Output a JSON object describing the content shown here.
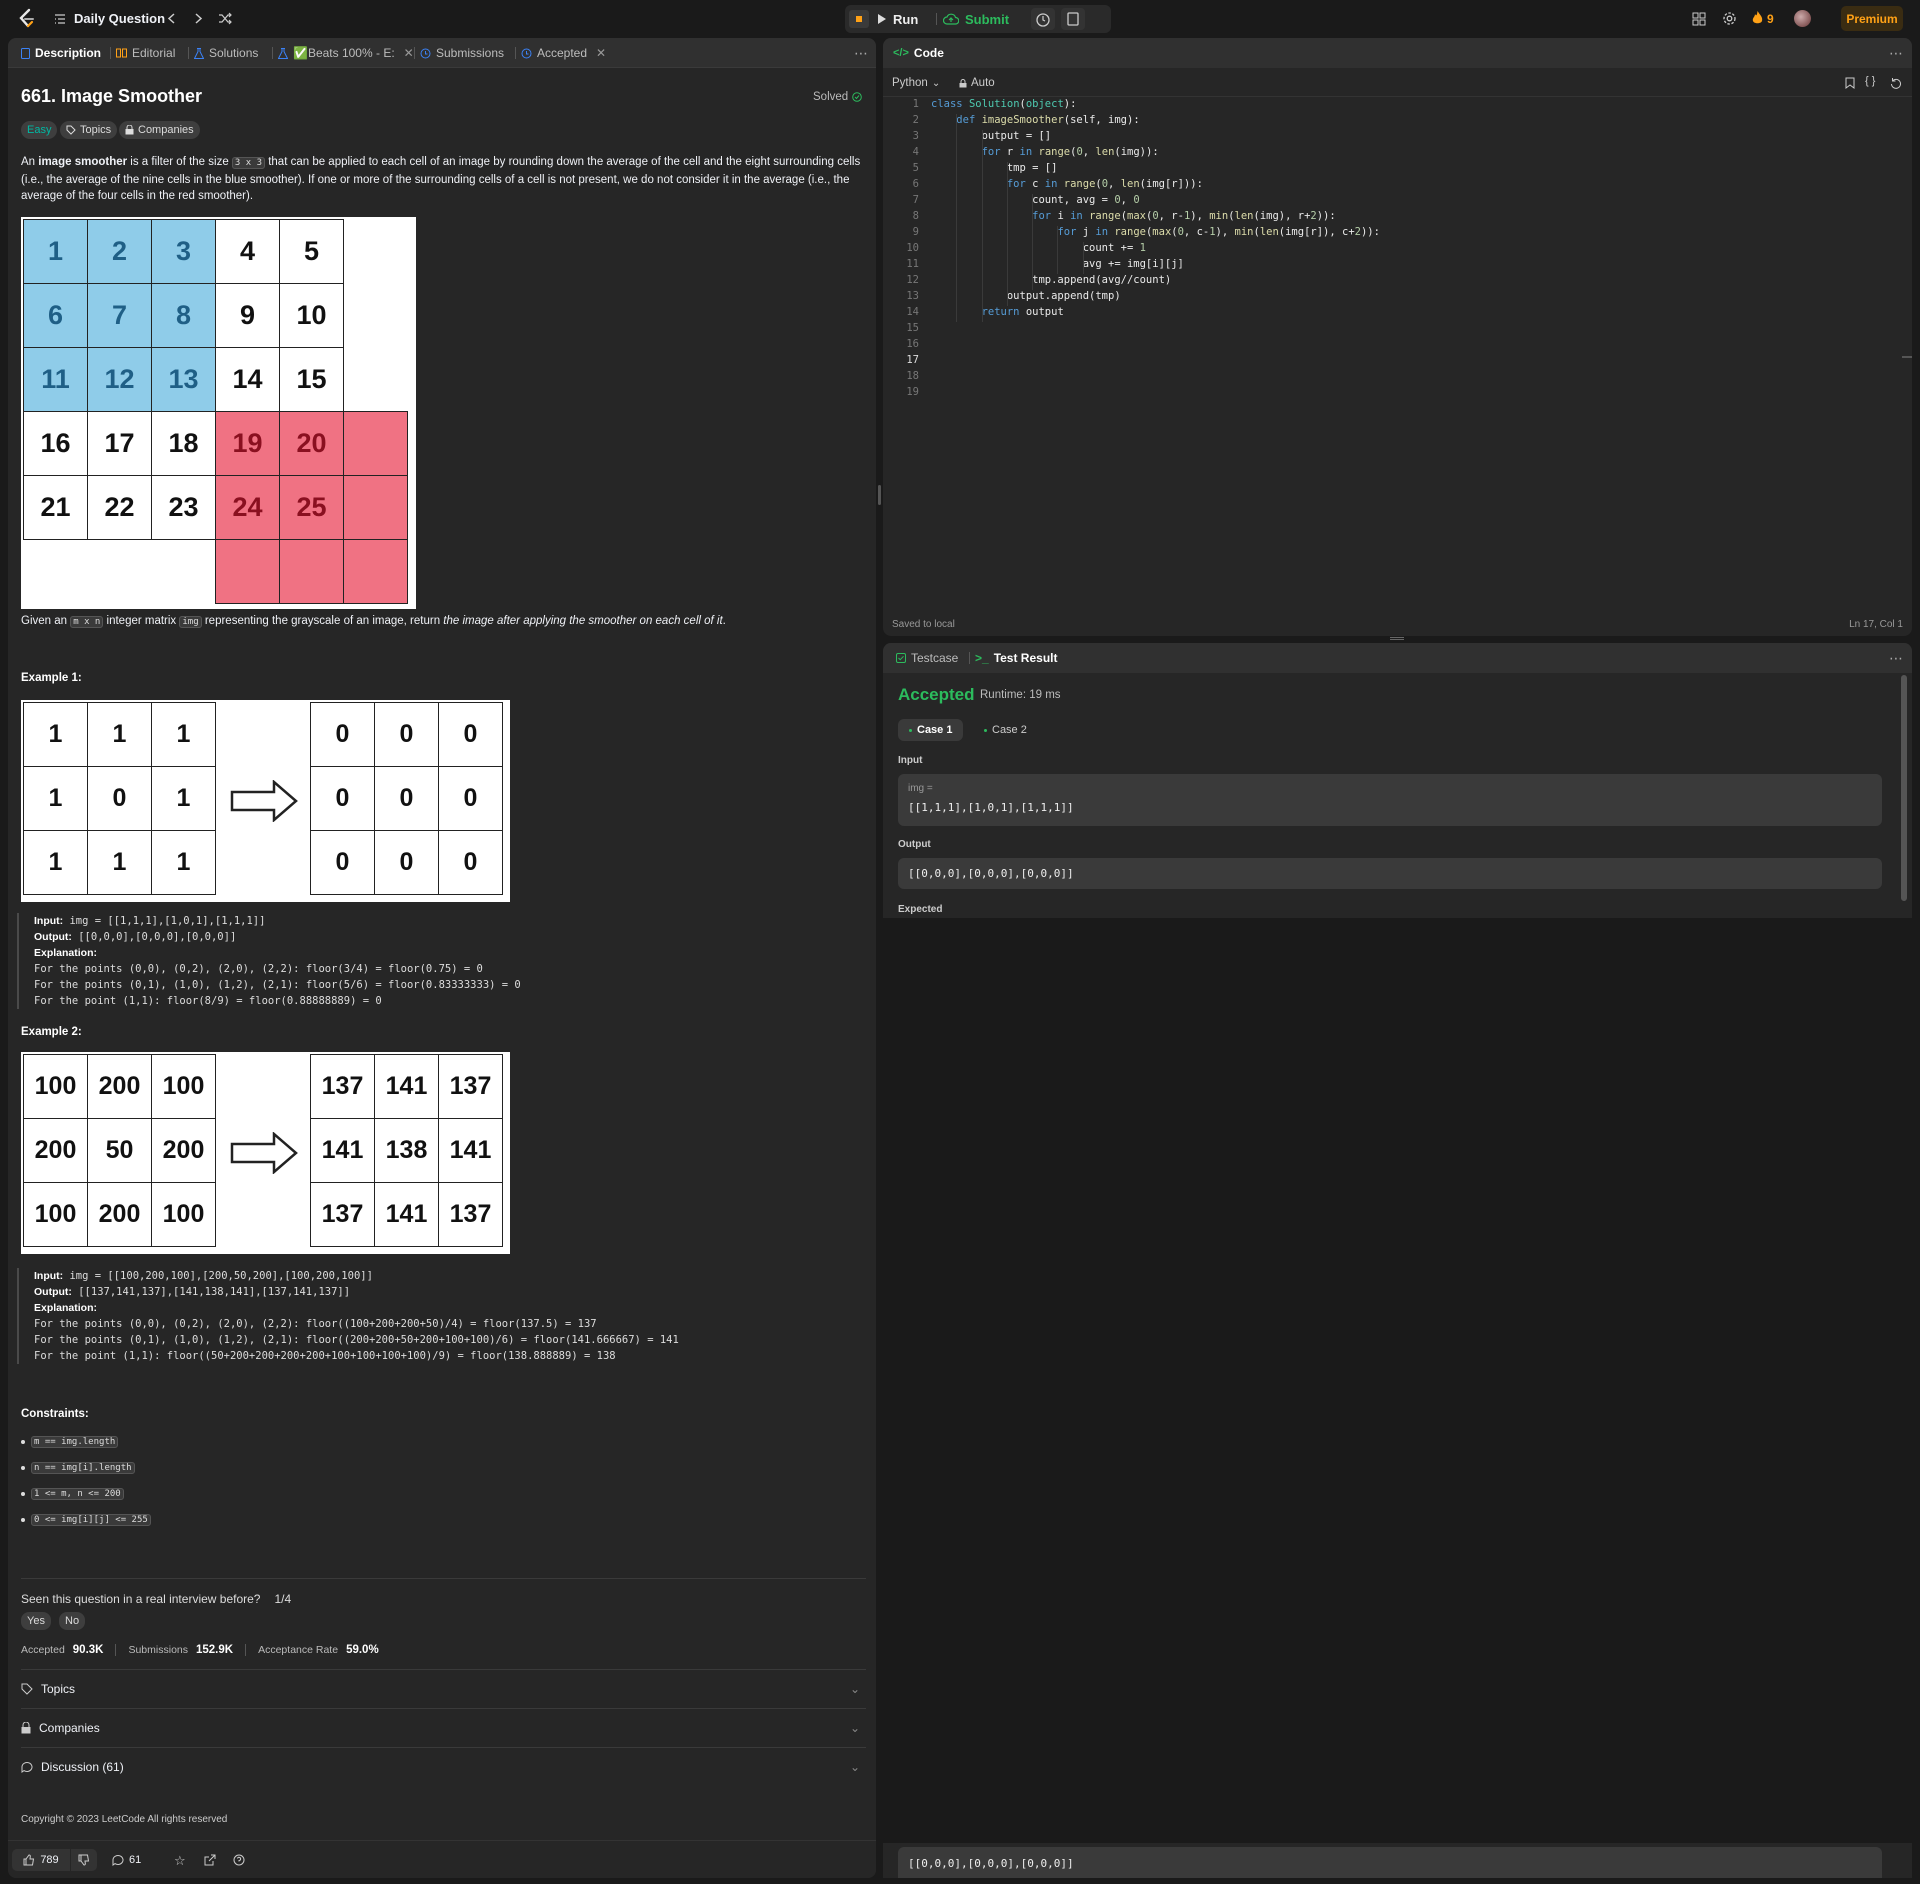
{
  "topbar": {
    "daily_question": "Daily Question",
    "run": "Run",
    "submit": "Submit",
    "streak": "9",
    "premium": "Premium"
  },
  "left_tabs": [
    {
      "label": "Description"
    },
    {
      "label": "Editorial"
    },
    {
      "label": "Solutions"
    },
    {
      "label": "✅Beats 100% - E:"
    },
    {
      "label": "Submissions"
    },
    {
      "label": "Accepted"
    }
  ],
  "problem": {
    "title": "661. Image Smoother",
    "solved": "Solved",
    "difficulty": "Easy",
    "topics_chip": "Topics",
    "companies_chip": "Companies",
    "desc_1": "An ",
    "desc_bold": "image smoother",
    "desc_2": " is a filter of the size ",
    "desc_code": "3 x 3",
    "desc_3": " that can be applied to each cell of an image by rounding down the average of the cell and the eight surrounding cells (i.e., the average of the nine cells in the blue smoother). If one or more of the surrounding cells of a cell is not present, we do not consider it in the average (i.e., the average of the four cells in the red smoother).",
    "given_1": "Given an ",
    "given_code1": "m x n",
    "given_2": " integer matrix ",
    "given_code2": "img",
    "given_3": " representing the grayscale of an image, return ",
    "given_italic": "the image after applying the smoother on each cell of it",
    "given_4": "."
  },
  "smoother_grid": [
    [
      "1",
      "2",
      "3",
      "4",
      "5"
    ],
    [
      "6",
      "7",
      "8",
      "9",
      "10"
    ],
    [
      "11",
      "12",
      "13",
      "14",
      "15"
    ],
    [
      "16",
      "17",
      "18",
      "19",
      "20"
    ],
    [
      "21",
      "22",
      "23",
      "24",
      "25"
    ]
  ],
  "example1": {
    "heading": "Example 1:",
    "in_grid": [
      [
        "1",
        "1",
        "1"
      ],
      [
        "1",
        "0",
        "1"
      ],
      [
        "1",
        "1",
        "1"
      ]
    ],
    "out_grid": [
      [
        "0",
        "0",
        "0"
      ],
      [
        "0",
        "0",
        "0"
      ],
      [
        "0",
        "0",
        "0"
      ]
    ],
    "input_label": "Input:",
    "input": " img = [[1,1,1],[1,0,1],[1,1,1]]",
    "output_label": "Output:",
    "output": " [[0,0,0],[0,0,0],[0,0,0]]",
    "explanation_label": "Explanation:",
    "lines": [
      "For the points (0,0), (0,2), (2,0), (2,2): floor(3/4) = floor(0.75) = 0",
      "For the points (0,1), (1,0), (1,2), (2,1): floor(5/6) = floor(0.83333333) = 0",
      "For the point (1,1): floor(8/9) = floor(0.88888889) = 0"
    ]
  },
  "example2": {
    "heading": "Example 2:",
    "in_grid": [
      [
        "100",
        "200",
        "100"
      ],
      [
        "200",
        "50",
        "200"
      ],
      [
        "100",
        "200",
        "100"
      ]
    ],
    "out_grid": [
      [
        "137",
        "141",
        "137"
      ],
      [
        "141",
        "138",
        "141"
      ],
      [
        "137",
        "141",
        "137"
      ]
    ],
    "input_label": "Input:",
    "input": " img = [[100,200,100],[200,50,200],[100,200,100]]",
    "output_label": "Output:",
    "output": " [[137,141,137],[141,138,141],[137,141,137]]",
    "explanation_label": "Explanation:",
    "lines": [
      "For the points (0,0), (0,2), (2,0), (2,2): floor((100+200+200+50)/4) = floor(137.5) = 137",
      "For the points (0,1), (1,0), (1,2), (2,1): floor((200+200+50+200+100+100)/6) = floor(141.666667) = 141",
      "For the point (1,1): floor((50+200+200+200+200+100+100+100+100)/9) = floor(138.888889) = 138"
    ]
  },
  "constraints": {
    "heading": "Constraints:",
    "items": [
      "m == img.length",
      "n == img[i].length",
      "1 <= m, n <= 200",
      "0 <= img[i][j] <= 255"
    ]
  },
  "interview": {
    "question": "Seen this question in a real interview before?",
    "count": "1/4",
    "yes": "Yes",
    "no": "No"
  },
  "stats": {
    "accepted_label": "Accepted",
    "accepted": "90.3K",
    "submissions_label": "Submissions",
    "submissions": "152.9K",
    "rate_label": "Acceptance Rate",
    "rate": "59.0%"
  },
  "accordions": [
    "Topics",
    "Companies",
    "Discussion (61)"
  ],
  "copyright": "Copyright © 2023 LeetCode All rights reserved",
  "footer": {
    "likes": "789",
    "comments": "61"
  },
  "code_panel": {
    "title": "Code",
    "language": "Python",
    "auto": "Auto",
    "saved": "Saved to local",
    "cursor": "Ln 17, Col 1",
    "line_numbers": [
      "1",
      "2",
      "3",
      "4",
      "5",
      "6",
      "7",
      "8",
      "9",
      "10",
      "11",
      "12",
      "13",
      "14",
      "15",
      "16",
      "17",
      "18",
      "19"
    ]
  },
  "test_panel": {
    "testcase_tab": "Testcase",
    "result_tab": "Test Result",
    "status": "Accepted",
    "runtime": "Runtime: 19 ms",
    "case1": "Case 1",
    "case2": "Case 2",
    "input_label": "Input",
    "var_name": "img =",
    "input_value": "[[1,1,1],[1,0,1],[1,1,1]]",
    "output_label": "Output",
    "output_value": "[[0,0,0],[0,0,0],[0,0,0]]",
    "expected_label": "Expected",
    "expected_value": "[[0,0,0],[0,0,0],[0,0,0]]"
  },
  "colors": {
    "accent": "#ffa116",
    "success": "#2cbb5d",
    "easy": "#00b8a3",
    "blue_cell": "#8fcce9",
    "red_cell": "#f07283"
  }
}
